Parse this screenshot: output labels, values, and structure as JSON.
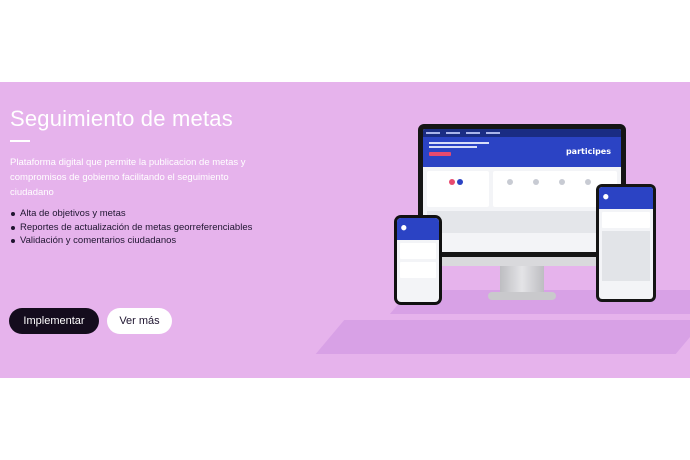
{
  "section": {
    "title": "Seguimiento de metas",
    "description": "Plataforma digital que permite la publicacion de metas y compromisos de gobierno facilitando el seguimiento ciudadano",
    "features": [
      "Alta de objetivos y metas",
      "Reportes de actualización de metas georreferenciables",
      "Validación y comentarios ciudadanos"
    ],
    "primary_button": "Implementar",
    "secondary_button": "Ver más"
  },
  "mockup": {
    "brand_logo": "participes"
  },
  "colors": {
    "banner_bg": "#e6b3ec",
    "primary_button": "#140c1d",
    "app_blue": "#2b43c4",
    "accent_pink": "#e84a6f"
  }
}
